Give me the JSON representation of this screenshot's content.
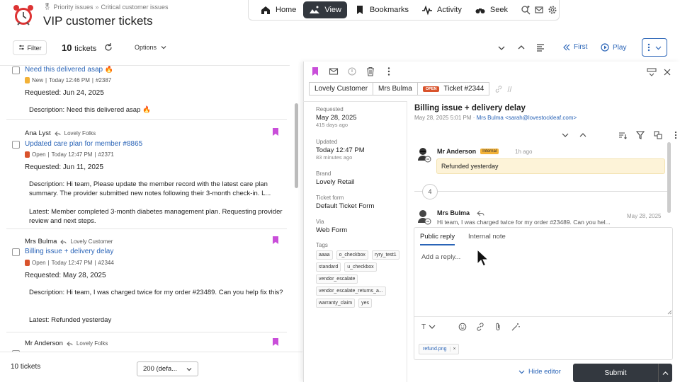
{
  "header": {
    "breadcrumb": [
      "Priority issues",
      "Critical customer issues"
    ],
    "breadcrumb_sep": "»",
    "title": "VIP customer tickets"
  },
  "topnav": {
    "items": [
      {
        "label": "Home",
        "icon": "home-icon"
      },
      {
        "label": "View",
        "icon": "view-icon",
        "active": true
      },
      {
        "label": "Bookmarks",
        "icon": "bookmark-icon"
      },
      {
        "label": "Activity",
        "icon": "activity-icon"
      },
      {
        "label": "Seek",
        "icon": "binoculars-icon"
      }
    ]
  },
  "toolbar": {
    "filter_label": "Filter",
    "count": "10",
    "count_unit": "tickets",
    "options_label": "Options",
    "first_label": "First",
    "play_label": "Play"
  },
  "tickets": [
    {
      "title": "Need this delivered asap 🔥",
      "status": "New",
      "status_color": "#f2b137",
      "time": "Today 12:46 PM",
      "id": "#2387",
      "requested": "Requested: Jun 24, 2025",
      "desc_label": "Description:",
      "desc": "Need this delivered asap 🔥"
    },
    {
      "from": "Ana Lyst",
      "org": "Lovely Folks",
      "title": "Updated care plan for member #8865",
      "status": "Open",
      "status_color": "#d9532c",
      "time": "Today 12:47 PM",
      "id": "#2371",
      "requested": "Requested: Jun 11, 2025",
      "desc_label": "Description:",
      "desc": "Hi team, Please update the member record with the latest care plan summary. The provider submitted new notes following their 3-month check-in. L...",
      "latest_label": "Latest:",
      "latest": "Member completed 3-month diabetes management plan. Requesting provider review and next steps."
    },
    {
      "from": "Mrs Bulma",
      "org": "Lovely Customer",
      "title": "Billing issue + delivery delay",
      "status": "Open",
      "status_color": "#d9532c",
      "time": "Today 12:47 PM",
      "id": "#2344",
      "requested": "Requested: May 28, 2025",
      "desc_label": "Description:",
      "desc": "Hi team, I was charged twice for my order #23489. Can you help fix this?",
      "latest_label": "Latest:",
      "latest": "Refunded yesterday"
    },
    {
      "from": "Mr Anderson",
      "org": "Lovely Folks"
    }
  ],
  "footer": {
    "count_label": "10 tickets",
    "page_size": "200 (defa..."
  },
  "panel": {
    "tabs": {
      "customer": "Lovely Customer",
      "requester": "Mrs Bulma",
      "status": "OPEN",
      "ticket": "Ticket #2344"
    },
    "fields": {
      "requested_label": "Requested",
      "requested": "May 28, 2025",
      "requested_ago": "415 days ago",
      "updated_label": "Updated",
      "updated": "Today 12:47 PM",
      "updated_ago": "83 minutes ago",
      "brand_label": "Brand",
      "brand": "Lovely Retail",
      "form_label": "Ticket form",
      "form": "Default Ticket Form",
      "via_label": "Via",
      "via": "Web Form",
      "tags_label": "Tags"
    },
    "tags": [
      "aaaa",
      "o_checkbox",
      "ryry_test1",
      "standard",
      "u_checkbox",
      "vendor_escalate",
      "vendor_escalate_returns_a...",
      "warranty_claim",
      "yes"
    ],
    "subject": "Billing issue + delivery delay",
    "subject_meta": "May 28, 2025 5:01 PM",
    "subject_from": "Mrs Bulma <sarah@lovestockleaf.com>",
    "messages": [
      {
        "author": "Mr Anderson",
        "badge": "Internal",
        "time": "1h ago",
        "body": "Refunded yesterday"
      },
      {
        "author": "Mrs Bulma",
        "time": "May 28, 2025",
        "body": "Hi team, I was charged twice for my order #23489. Can you hel..."
      }
    ],
    "collapsed_count": "4",
    "editor": {
      "tab_public": "Public reply",
      "tab_internal": "Internal note",
      "placeholder": "Add a reply...",
      "text_tool": "T",
      "attachment": "refund.png",
      "attachment_remove": "×",
      "hide_label": "Hide editor",
      "submit_label": "Submit"
    }
  },
  "colors": {
    "accent": "#2a64b7",
    "dark": "#33383f",
    "open": "#d9532c",
    "new": "#f2b137",
    "bookmark": "#c94ed9"
  }
}
